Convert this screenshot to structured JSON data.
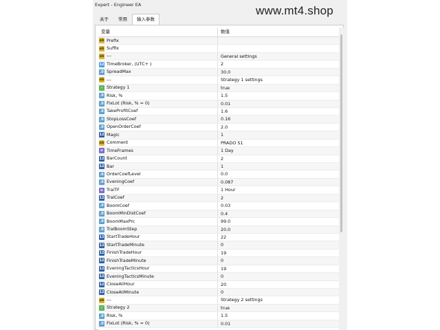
{
  "window": {
    "title": "Expert - Engineer EA"
  },
  "watermark": "www.mt4.shop",
  "tabs": [
    {
      "label": "关于"
    },
    {
      "label": "常用"
    },
    {
      "label": "输入参数"
    }
  ],
  "grid": {
    "headers": {
      "variable": "变量",
      "value": "数值"
    },
    "rows": [
      {
        "name": "Prefix",
        "value": "",
        "icon": "ab"
      },
      {
        "name": "Suffix",
        "value": "",
        "icon": "ab"
      },
      {
        "name": "---",
        "value": "General settings",
        "icon": "ab"
      },
      {
        "name": "TimeBroker, (UTC+ )",
        "value": "2",
        "icon": "num"
      },
      {
        "name": "SpreadMax",
        "value": "30.0",
        "icon": "val"
      },
      {
        "name": "---",
        "value": "Strategy 1 settings",
        "icon": "ab"
      },
      {
        "name": "Strategy 1",
        "value": "true",
        "icon": "bool"
      },
      {
        "name": "Risk, %",
        "value": "1.5",
        "icon": "val"
      },
      {
        "name": "FixLot (Risk, % = 0)",
        "value": "0.01",
        "icon": "val"
      },
      {
        "name": "TakeProfitCoef",
        "value": "1.6",
        "icon": "val"
      },
      {
        "name": "StopLossCoef",
        "value": "0.16",
        "icon": "val"
      },
      {
        "name": "OpenOrderCoef",
        "value": "2.0",
        "icon": "val"
      },
      {
        "name": "Magic",
        "value": "1",
        "icon": "int"
      },
      {
        "name": "Comment",
        "value": "PRADO S1",
        "icon": "ab"
      },
      {
        "name": "TimeFrames",
        "value": "1 Day",
        "icon": "enum"
      },
      {
        "name": "BarCount",
        "value": "2",
        "icon": "int"
      },
      {
        "name": "Bar",
        "value": "1",
        "icon": "int"
      },
      {
        "name": "OrderCoefLevel",
        "value": "0.0",
        "icon": "val"
      },
      {
        "name": "EveningCoef",
        "value": "0.087",
        "icon": "val"
      },
      {
        "name": "TralTF",
        "value": "1 Hour",
        "icon": "enum"
      },
      {
        "name": "TralCoef",
        "value": "2",
        "icon": "int"
      },
      {
        "name": "BoomCoef",
        "value": "0.03",
        "icon": "val"
      },
      {
        "name": "BoomMinDistCoef",
        "value": "0.4",
        "icon": "val"
      },
      {
        "name": "BoomMaxPrc",
        "value": "99.0",
        "icon": "val"
      },
      {
        "name": "TralBoomStep",
        "value": "20.0",
        "icon": "val"
      },
      {
        "name": "StartTradeHour",
        "value": "22",
        "icon": "int"
      },
      {
        "name": "StartTradeMinute",
        "value": "0",
        "icon": "int"
      },
      {
        "name": "FinishTradeHour",
        "value": "19",
        "icon": "int"
      },
      {
        "name": "FinishTradeMinute",
        "value": "0",
        "icon": "int"
      },
      {
        "name": "EveningTacticsHour",
        "value": "19",
        "icon": "int"
      },
      {
        "name": "EveningTacticsMinute",
        "value": "0",
        "icon": "int"
      },
      {
        "name": "CloseAllHour",
        "value": "20",
        "icon": "int"
      },
      {
        "name": "CloseAllMinute",
        "value": "0",
        "icon": "int"
      },
      {
        "name": "---",
        "value": "Strategy 2 settings",
        "icon": "ab"
      },
      {
        "name": "Strategy 2",
        "value": "true",
        "icon": "bool"
      },
      {
        "name": "Risk, %",
        "value": "1.5",
        "icon": "val"
      },
      {
        "name": "FixLot (Risk, % = 0)",
        "value": "0.01",
        "icon": "val"
      }
    ]
  },
  "icon_names": {
    "ab": "string-param-icon",
    "num": "number-param-icon",
    "val": "double-param-icon",
    "int": "integer-param-icon",
    "bool": "bool-param-icon",
    "enum": "enum-param-icon"
  },
  "colors": {
    "accent_int": "#2f5fa6",
    "accent_double": "#5f9fd0",
    "accent_string": "#d9b53a"
  }
}
